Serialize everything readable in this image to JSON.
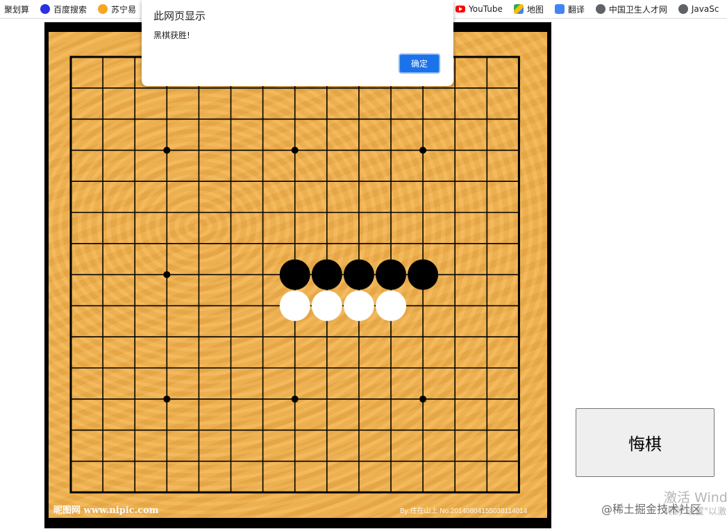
{
  "bookmarks": [
    {
      "label": "聚划算",
      "icon": "none"
    },
    {
      "label": "百度搜索",
      "icon": "baidu-paw-icon"
    },
    {
      "label": "苏宁易",
      "icon": "suning-icon"
    },
    {
      "label": "YouTube",
      "icon": "youtube-icon"
    },
    {
      "label": "地图",
      "icon": "maps-icon"
    },
    {
      "label": "翻译",
      "icon": "translate-icon"
    },
    {
      "label": "中国卫生人才网",
      "icon": "globe-icon"
    },
    {
      "label": "JavaSc",
      "icon": "globe-icon"
    }
  ],
  "dialog": {
    "title": "此网页显示",
    "message": "黑棋获胜!",
    "ok_label": "确定"
  },
  "board": {
    "size": 15,
    "star_points": [
      [
        3,
        3
      ],
      [
        7,
        3
      ],
      [
        11,
        3
      ],
      [
        3,
        7
      ],
      [
        3,
        11
      ],
      [
        7,
        11
      ],
      [
        11,
        11
      ]
    ],
    "black_stones": [
      [
        7,
        7
      ],
      [
        8,
        7
      ],
      [
        9,
        7
      ],
      [
        10,
        7
      ],
      [
        11,
        7
      ]
    ],
    "white_stones": [
      [
        7,
        8
      ],
      [
        8,
        8
      ],
      [
        9,
        8
      ],
      [
        10,
        8
      ]
    ],
    "colors": {
      "wood": "#f2b24e",
      "line": "#000000",
      "black": "#000000",
      "white": "#ffffff"
    }
  },
  "watermark": {
    "left": "昵图网 www.nipic.com",
    "right": "By:住在山上 No:20140804155038114014"
  },
  "controls": {
    "undo_label": "悔棋"
  },
  "overlay": {
    "activate_title": "激活 Wind",
    "activate_sub": "转到\"设置\"以激",
    "juejin": "@稀土掘金技术社区"
  }
}
